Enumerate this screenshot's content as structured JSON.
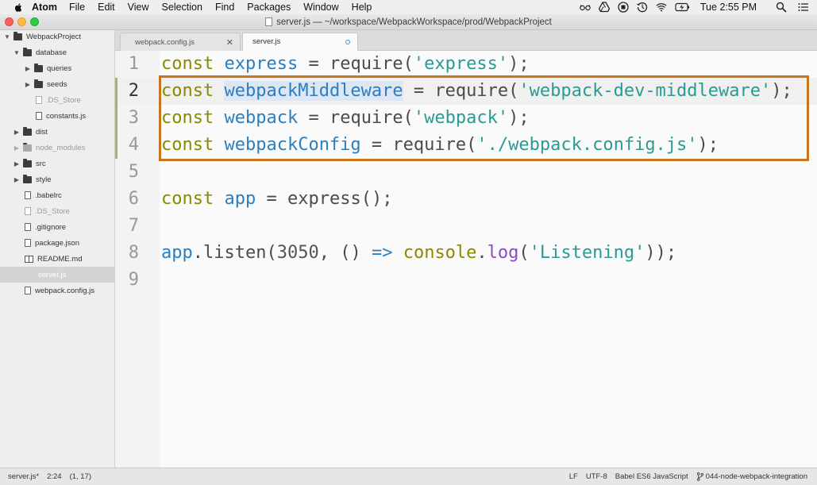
{
  "menubar": {
    "app_name": "Atom",
    "items": [
      "File",
      "Edit",
      "View",
      "Selection",
      "Find",
      "Packages",
      "Window",
      "Help"
    ],
    "clock": "Tue 2:55 PM"
  },
  "window": {
    "title": "server.js — ~/workspace/WebpackWorkspace/prod/WebpackProject"
  },
  "tree": {
    "items": [
      {
        "label": "WebpackProject",
        "type": "folder",
        "expanded": true
      },
      {
        "label": "database",
        "type": "folder",
        "expanded": true
      },
      {
        "label": "queries",
        "type": "folder",
        "expanded": false
      },
      {
        "label": "seeds",
        "type": "folder",
        "expanded": false
      },
      {
        "label": ".DS_Store",
        "type": "file",
        "dim": true
      },
      {
        "label": "constants.js",
        "type": "file"
      },
      {
        "label": "dist",
        "type": "folder",
        "expanded": false
      },
      {
        "label": "node_modules",
        "type": "folder",
        "expanded": false,
        "dim": true
      },
      {
        "label": "src",
        "type": "folder",
        "expanded": false
      },
      {
        "label": "style",
        "type": "folder",
        "expanded": false
      },
      {
        "label": ".babelrc",
        "type": "file"
      },
      {
        "label": ".DS_Store",
        "type": "file",
        "dim": true
      },
      {
        "label": ".gitignore",
        "type": "file"
      },
      {
        "label": "package.json",
        "type": "file"
      },
      {
        "label": "README.md",
        "type": "book"
      },
      {
        "label": "server.js",
        "type": "file",
        "selected": true
      },
      {
        "label": "webpack.config.js",
        "type": "file"
      }
    ]
  },
  "tabs": [
    {
      "label": "webpack.config.js",
      "active": false
    },
    {
      "label": "server.js",
      "active": true,
      "modified": true
    }
  ],
  "editor": {
    "line_numbers": [
      "1",
      "2",
      "3",
      "4",
      "5",
      "6",
      "7",
      "8",
      "9"
    ],
    "lines": {
      "l1": {
        "kw": "const",
        "var": "express",
        "eq": " = ",
        "fn": "require(",
        "str": "'express'",
        "end": ");"
      },
      "l2": {
        "kw": "const",
        "var_a": "webpack",
        "var_b": "Middleware",
        "eq": " = ",
        "fn": "require(",
        "str": "'webpack-dev-middleware'",
        "end": ");"
      },
      "l3": {
        "kw": "const",
        "var": "webpack",
        "eq": " = ",
        "fn": "require(",
        "str": "'webpack'",
        "end": ");"
      },
      "l4": {
        "kw": "const",
        "var": "webpackConfig",
        "eq": " = ",
        "fn": "require(",
        "str": "'./webpack.config.js'",
        "end": ");"
      },
      "l6": {
        "kw": "const",
        "var": "app",
        "eq": " = ",
        "fn": "express();"
      },
      "l8": {
        "obj": "app",
        "dot": ".",
        "method": "listen",
        "open": "(",
        "num": "3050",
        "comma": ", () ",
        "arrow": "=>",
        "sp": " ",
        "console": "console",
        "dot2": ".",
        "log": "log",
        "open2": "(",
        "str": "'Listening'",
        "end": "));"
      }
    }
  },
  "statusbar": {
    "file": "server.js*",
    "cursor": "2:24",
    "selection": "(1, 17)",
    "line_ending": "LF",
    "encoding": "UTF-8",
    "grammar": "Babel ES6 JavaScript",
    "branch": "044-node-webpack-integration"
  },
  "colors": {
    "highlight_box": "#c9751a",
    "keyword": "#8a8a00",
    "variable": "#2b7fbd",
    "string": "#2a9a93"
  }
}
